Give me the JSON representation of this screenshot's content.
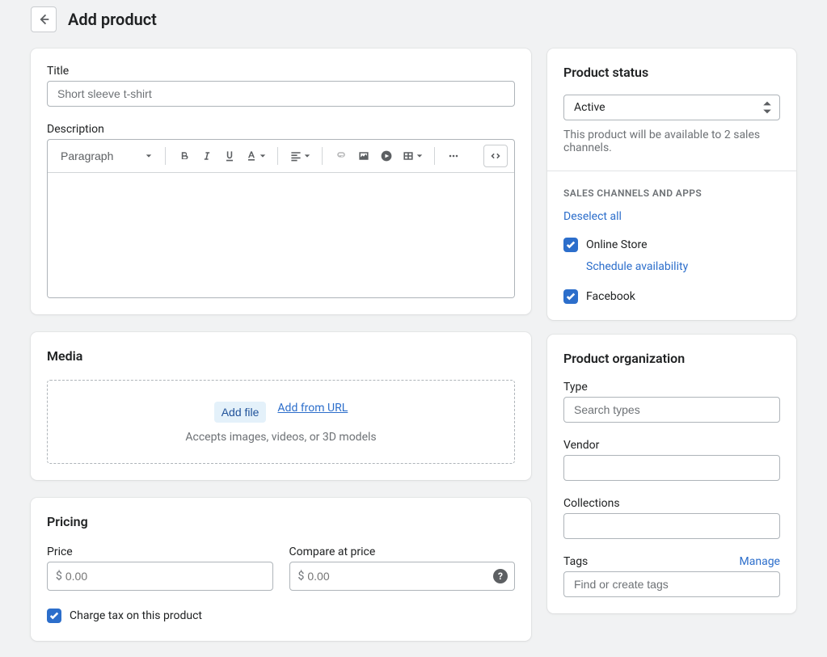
{
  "header": {
    "title": "Add product"
  },
  "mainCard": {
    "titleLabel": "Title",
    "titlePlaceholder": "Short sleeve t-shirt",
    "descriptionLabel": "Description",
    "formatLabel": "Paragraph"
  },
  "media": {
    "heading": "Media",
    "addFile": "Add file",
    "addFromUrl": "Add from URL",
    "hint": "Accepts images, videos, or 3D models"
  },
  "pricing": {
    "heading": "Pricing",
    "priceLabel": "Price",
    "compareLabel": "Compare at price",
    "currencySymbol": "$",
    "pricePlaceholder": "0.00",
    "comparePlaceholder": "0.00",
    "chargeTaxLabel": "Charge tax on this product"
  },
  "status": {
    "heading": "Product status",
    "selected": "Active",
    "helpText": "This product will be available to 2 sales channels.",
    "channelsHeading": "SALES CHANNELS AND APPS",
    "deselect": "Deselect all",
    "channel1": "Online Store",
    "schedule": "Schedule availability",
    "channel2": "Facebook"
  },
  "organization": {
    "heading": "Product organization",
    "typeLabel": "Type",
    "typePlaceholder": "Search types",
    "vendorLabel": "Vendor",
    "collectionsLabel": "Collections",
    "tagsLabel": "Tags",
    "manage": "Manage",
    "tagsPlaceholder": "Find or create tags"
  }
}
